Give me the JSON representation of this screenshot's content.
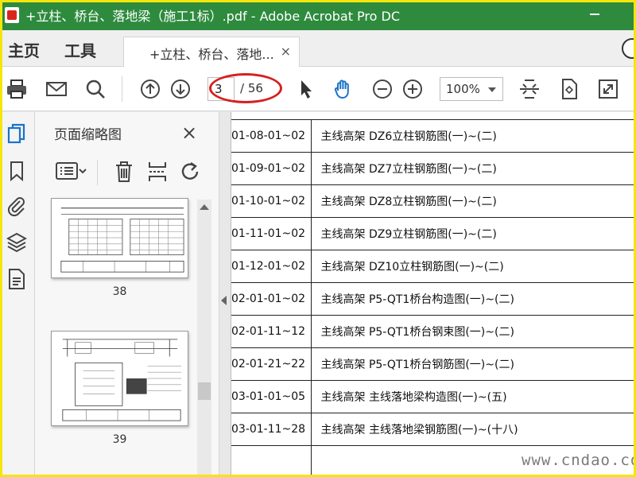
{
  "window": {
    "title": "+立柱、桥台、落地梁（施工1标）.pdf - Adobe Acrobat Pro DC"
  },
  "menu": {
    "home": "主页",
    "tools": "工具",
    "doc_tab": "+立柱、桥台、落地...",
    "tab_close": "×"
  },
  "toolbar": {
    "current_page": "3",
    "page_total": "/ 56",
    "zoom": "100%"
  },
  "thumbnails": {
    "title": "页面缩略图",
    "close": "×",
    "pages": [
      "38",
      "39"
    ]
  },
  "document": {
    "rows": [
      {
        "code": "01-08-01~02",
        "name": "主线高架 DZ6立柱钢筋图(一)~(二)"
      },
      {
        "code": "01-09-01~02",
        "name": "主线高架 DZ7立柱钢筋图(一)~(二)"
      },
      {
        "code": "01-10-01~02",
        "name": "主线高架 DZ8立柱钢筋图(一)~(二)"
      },
      {
        "code": "01-11-01~02",
        "name": "主线高架 DZ9立柱钢筋图(一)~(二)"
      },
      {
        "code": "01-12-01~02",
        "name": "主线高架 DZ10立柱钢筋图(一)~(二)"
      },
      {
        "code": "02-01-01~02",
        "name": "主线高架 P5-QT1桥台构造图(一)~(二)"
      },
      {
        "code": "02-01-11~12",
        "name": "主线高架 P5-QT1桥台钢束图(一)~(二)"
      },
      {
        "code": "02-01-21~22",
        "name": "主线高架 P5-QT1桥台钢筋图(一)~(二)"
      },
      {
        "code": "03-01-01~05",
        "name": "主线高架 主线落地梁构造图(一)~(五)"
      },
      {
        "code": "03-01-11~28",
        "name": "主线高架 主线落地梁钢筋图(一)~(十八)"
      },
      {
        "code": "",
        "name": ""
      }
    ]
  },
  "watermark": "www.cndao.com",
  "colors": {
    "titlebar": "#2e8b3e",
    "accent_blue": "#1a73c9",
    "annotation_red": "#d62020",
    "frame_yellow": "#f5e60a"
  },
  "icons": [
    "print-icon",
    "email-icon",
    "search-icon",
    "page-up-icon",
    "page-down-icon",
    "select-arrow-icon",
    "hand-icon",
    "zoom-out-icon",
    "zoom-in-icon",
    "fit-page-icon",
    "rotate-page-icon",
    "fullscreen-icon",
    "pages-icon",
    "bookmark-icon",
    "attachment-icon",
    "layers-icon",
    "content-icon",
    "options-icon",
    "delete-icon",
    "extract-icon",
    "rotate-icon"
  ]
}
